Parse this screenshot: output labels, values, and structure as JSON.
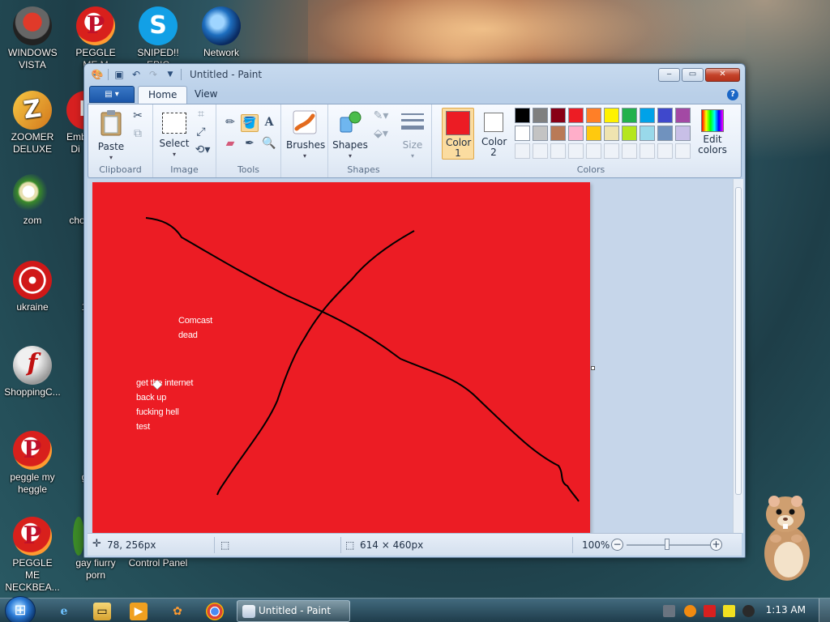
{
  "desktop": {
    "icons": [
      {
        "label": "WINDOWS VISTA"
      },
      {
        "label": "PEGGLE ME M"
      },
      {
        "label": "SNIPED!! EPIC"
      },
      {
        "label": "Network"
      },
      {
        "label": "ZOOMER DELUXE"
      },
      {
        "label": "Emb Di"
      },
      {
        "label": "zom"
      },
      {
        "label": "cho"
      },
      {
        "label": "ukraine"
      },
      {
        "label": "1"
      },
      {
        "label": "ShoppingC..."
      },
      {
        "label": "peggle my heggle"
      },
      {
        "label": "g"
      },
      {
        "label": "PEGGLE ME NECKBEA..."
      },
      {
        "label": "gay fiurry porn"
      },
      {
        "label": "Control Panel"
      }
    ]
  },
  "window": {
    "title": "Untitled - Paint",
    "controls": {
      "minimize": "‒",
      "maximize": "▭",
      "close": "✕"
    },
    "tabs": [
      {
        "label": "Home",
        "active": true
      },
      {
        "label": "View",
        "active": false
      }
    ],
    "groups": {
      "clipboard": {
        "label": "Clipboard",
        "paste": "Paste"
      },
      "image": {
        "label": "Image",
        "select": "Select"
      },
      "tools": {
        "label": "Tools"
      },
      "brushes": {
        "label": "Brushes"
      },
      "shapes": {
        "label": "Shapes",
        "button": "Shapes",
        "size": "Size"
      },
      "colors": {
        "label": "Colors",
        "color1": "Color 1",
        "color2": "Color 2",
        "edit": "Edit colors",
        "color1_value": "#ec1c24",
        "color2_value": "#ffffff",
        "palette_row1": [
          "#000000",
          "#7f7f7f",
          "#880015",
          "#ed1c24",
          "#ff7f27",
          "#fff200",
          "#22b14c",
          "#00a2e8",
          "#3f48cc",
          "#a349a4"
        ],
        "palette_row2": [
          "#ffffff",
          "#c3c3c3",
          "#b97a57",
          "#ffaec9",
          "#ffc90e",
          "#efe4b0",
          "#b5e61d",
          "#99d9ea",
          "#7092be",
          "#c8bfe7"
        ]
      }
    },
    "canvas": {
      "background": "#ec1c24",
      "text1": [
        "Comcast",
        "dead"
      ],
      "text2": [
        "get the internet",
        "back up",
        "fucking hell",
        "test"
      ]
    },
    "status": {
      "cursor_pos": "78, 256px",
      "canvas_size": "614 × 460px",
      "zoom": "100%"
    }
  },
  "taskbar": {
    "active_task": "Untitled - Paint",
    "clock": "1:13 AM"
  }
}
